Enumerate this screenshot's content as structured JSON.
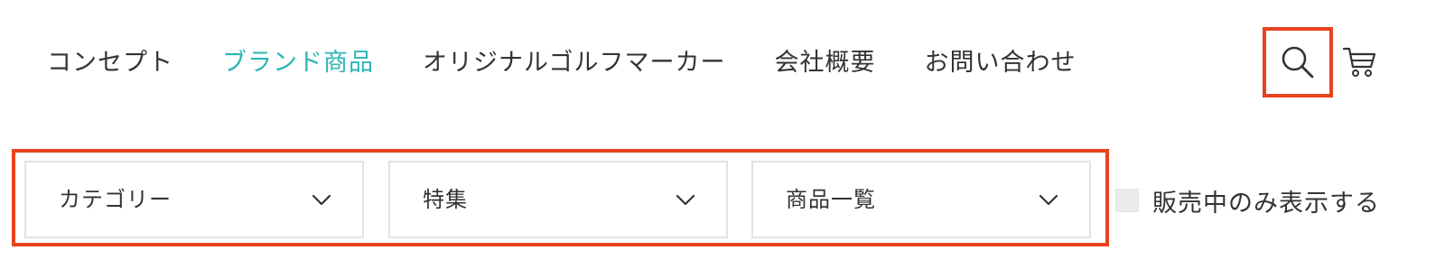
{
  "nav": {
    "items": [
      {
        "label": "コンセプト",
        "active": false
      },
      {
        "label": "ブランド商品",
        "active": true
      },
      {
        "label": "オリジナルゴルフマーカー",
        "active": false
      },
      {
        "label": "会社概要",
        "active": false
      },
      {
        "label": "お問い合わせ",
        "active": false
      }
    ],
    "active_color": "#2bb6b4",
    "search_icon": "search-icon",
    "cart_icon": "cart-icon"
  },
  "filters": {
    "category": {
      "label": "カテゴリー",
      "icon": "chevron-down-icon"
    },
    "feature": {
      "label": "特集",
      "icon": "chevron-down-icon"
    },
    "products": {
      "label": "商品一覧",
      "icon": "chevron-down-icon"
    },
    "in_stock_only": {
      "label": "販売中のみ表示する",
      "checked": false
    }
  },
  "highlight_color": "#e8431f"
}
